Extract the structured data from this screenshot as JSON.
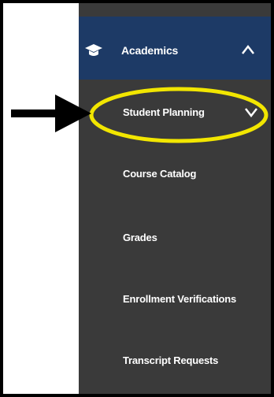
{
  "nav": {
    "header": {
      "label": "Academics",
      "icon": "graduation-cap-icon",
      "expand_icon": "chevron-up-icon"
    },
    "items": [
      {
        "label": "Student Planning",
        "icon": "chevron-down-icon"
      },
      {
        "label": "Course Catalog"
      },
      {
        "label": "Grades"
      },
      {
        "label": "Enrollment Verifications"
      },
      {
        "label": "Transcript Requests"
      }
    ]
  },
  "annotation": {
    "highlight_color": "#f2e600",
    "arrow_color": "#000000"
  },
  "colors": {
    "header_bg": "#1d3a66",
    "menu_bg": "#3a3a3a",
    "text": "#ffffff"
  }
}
